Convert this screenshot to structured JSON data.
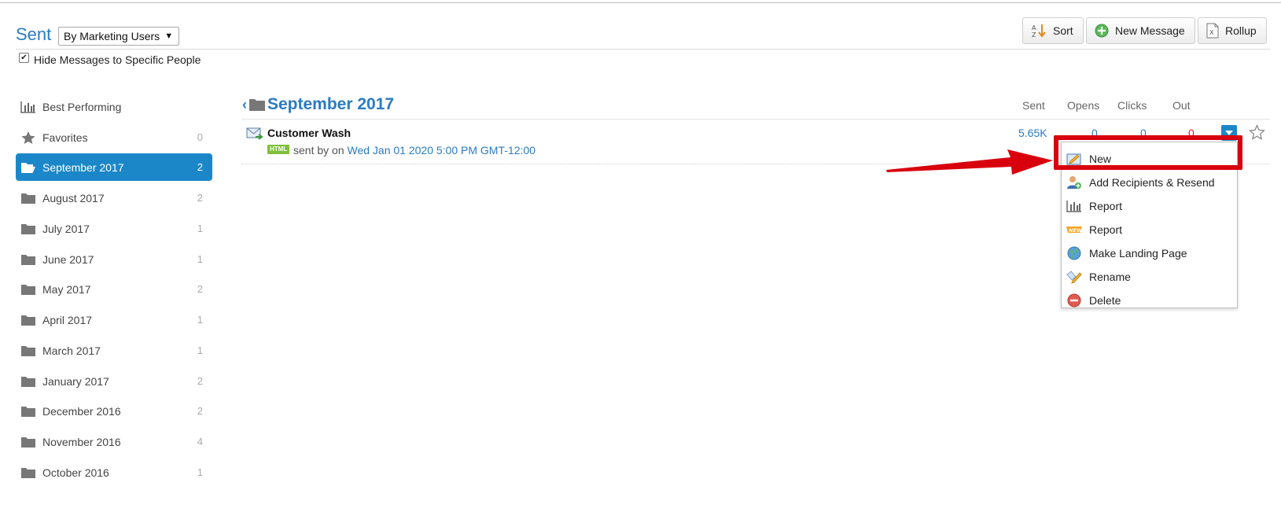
{
  "header": {
    "title": "Sent",
    "view_select": "By Marketing Users",
    "hide_checkbox_label": "Hide Messages to Specific People",
    "hide_checkbox_checked": true
  },
  "toolbar": {
    "sort_label": "Sort",
    "new_message_label": "New Message",
    "rollup_label": "Rollup"
  },
  "sidebar": {
    "items": [
      {
        "label": "Best Performing",
        "count": "",
        "icon": "bar-chart-icon"
      },
      {
        "label": "Favorites",
        "count": "0",
        "icon": "star-icon"
      },
      {
        "label": "September 2017",
        "count": "2",
        "icon": "folder-open-icon",
        "active": true
      },
      {
        "label": "August 2017",
        "count": "2",
        "icon": "folder-icon"
      },
      {
        "label": "July 2017",
        "count": "1",
        "icon": "folder-icon"
      },
      {
        "label": "June 2017",
        "count": "1",
        "icon": "folder-icon"
      },
      {
        "label": "May 2017",
        "count": "2",
        "icon": "folder-icon"
      },
      {
        "label": "April 2017",
        "count": "1",
        "icon": "folder-icon"
      },
      {
        "label": "March 2017",
        "count": "1",
        "icon": "folder-icon"
      },
      {
        "label": "January 2017",
        "count": "2",
        "icon": "folder-icon"
      },
      {
        "label": "December 2016",
        "count": "2",
        "icon": "folder-icon"
      },
      {
        "label": "November 2016",
        "count": "4",
        "icon": "folder-icon"
      },
      {
        "label": "October 2016",
        "count": "1",
        "icon": "folder-icon"
      }
    ]
  },
  "main": {
    "folder_title": "September 2017",
    "columns": [
      "Sent",
      "Opens",
      "Clicks",
      "Out"
    ],
    "messages": [
      {
        "name": "Customer Wash",
        "badge": "HTML",
        "sent_by_prefix": "sent by on",
        "date": "Wed Jan 01 2020 5:00 PM GMT-12:00",
        "sent": "5.65K",
        "opens": "0",
        "clicks": "0",
        "out": "0"
      }
    ]
  },
  "context_menu": {
    "items": [
      {
        "label": "New",
        "icon": "new-message-icon"
      },
      {
        "label": "Add Recipients & Resend",
        "icon": "add-user-icon"
      },
      {
        "label": "Report",
        "icon": "bar-chart-icon"
      },
      {
        "label": "Report",
        "icon": "new-badge-icon"
      },
      {
        "label": "Make Landing Page",
        "icon": "globe-icon"
      },
      {
        "label": "Rename",
        "icon": "pencil-icon"
      },
      {
        "label": "Delete",
        "icon": "delete-icon"
      }
    ]
  },
  "colors": {
    "accent": "#2b7bc1",
    "active_bg": "#1b87c9",
    "annotation": "#d9000d",
    "out_value": "#e02020"
  }
}
